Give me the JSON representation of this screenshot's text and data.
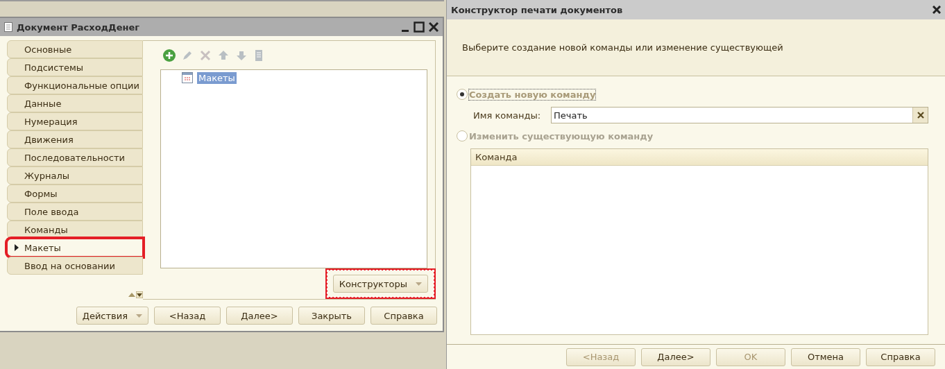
{
  "left_window": {
    "title": "Документ РасходДенег",
    "tabs": [
      {
        "label": "Основные",
        "selected": false
      },
      {
        "label": "Подсистемы",
        "selected": false
      },
      {
        "label": "Функциональные опции",
        "selected": false
      },
      {
        "label": "Данные",
        "selected": false
      },
      {
        "label": "Нумерация",
        "selected": false
      },
      {
        "label": "Движения",
        "selected": false
      },
      {
        "label": "Последовательности",
        "selected": false
      },
      {
        "label": "Журналы",
        "selected": false
      },
      {
        "label": "Формы",
        "selected": false
      },
      {
        "label": "Поле ввода",
        "selected": false
      },
      {
        "label": "Команды",
        "selected": false
      },
      {
        "label": "Макеты",
        "selected": true
      },
      {
        "label": "Ввод на основании",
        "selected": false
      }
    ],
    "toolbar": [
      {
        "kind": "add",
        "disabled": false
      },
      {
        "kind": "edit",
        "disabled": true
      },
      {
        "kind": "delete",
        "disabled": true
      },
      {
        "kind": "up",
        "disabled": true
      },
      {
        "kind": "down",
        "disabled": true
      },
      {
        "kind": "sort",
        "disabled": true
      }
    ],
    "tree": [
      {
        "label": "Макеты",
        "selected": true
      }
    ],
    "designer_button": "Конструкторы",
    "buttons": [
      {
        "label": "Действия",
        "kind": "menu"
      },
      {
        "label": "<Назад",
        "kind": "plain"
      },
      {
        "label": "Далее>",
        "kind": "plain"
      },
      {
        "label": "Закрыть",
        "kind": "plain"
      },
      {
        "label": "Справка",
        "kind": "plain"
      }
    ]
  },
  "dialog": {
    "title": "Конструктор печати документов",
    "prompt": "Выберите создание новой команды или изменение существующей",
    "options": [
      {
        "label": "Создать новую команду",
        "selected": true
      },
      {
        "label": "Изменить существующую команду",
        "selected": false
      }
    ],
    "field": {
      "label": "Имя команды:",
      "value": "Печать"
    },
    "table": {
      "columns": [
        "Команда"
      ]
    },
    "buttons": [
      {
        "label": "<Назад",
        "disabled": true
      },
      {
        "label": "Далее>",
        "disabled": false
      },
      {
        "label": "OK",
        "disabled": true
      },
      {
        "label": "Отмена",
        "disabled": false
      },
      {
        "label": "Справка",
        "disabled": false
      }
    ]
  }
}
